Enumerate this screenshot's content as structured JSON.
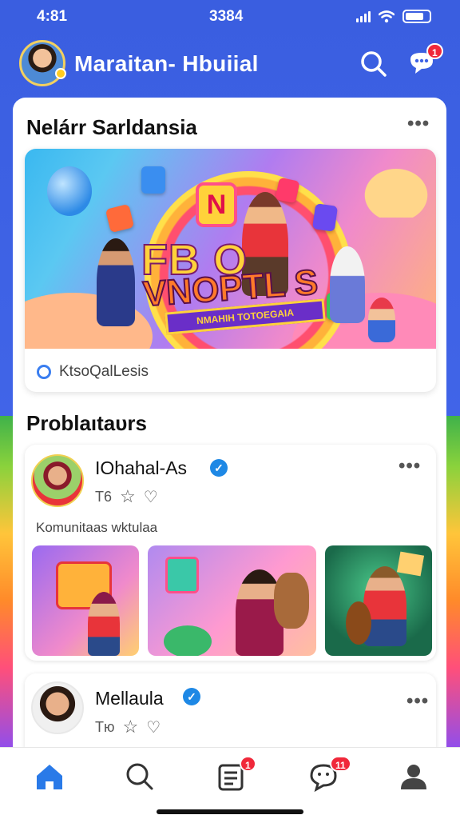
{
  "status_bar": {
    "time_left": "4:81",
    "time_center": "3384"
  },
  "header": {
    "title": "Maraitan- Hbuiial",
    "chat_badge": "1"
  },
  "featured_section": {
    "title": "Nelárr Sarldansia",
    "banner_text": {
      "letter": "N",
      "line1": "FB   O",
      "line2": "VNOPTL S",
      "ribbon": "NMAHIH TOTOEGAIA"
    },
    "meta_label": "KtsoQalLesis"
  },
  "posts_section": {
    "title": "Problaıtaᴜrs",
    "posts": [
      {
        "name": "IOhahal-As",
        "count": "T6",
        "caption": "Komunitaas wktulaa"
      },
      {
        "name": "Mellaula",
        "count": "Tю",
        "caption": ""
      }
    ]
  },
  "nav": {
    "items": [
      "home",
      "search",
      "feed",
      "messages",
      "profile"
    ],
    "feed_badge": "1",
    "messages_badge": "11"
  },
  "colors": {
    "accent": "#1e88e5",
    "header_bg": "#3f63e6",
    "badge": "#f0283a"
  }
}
